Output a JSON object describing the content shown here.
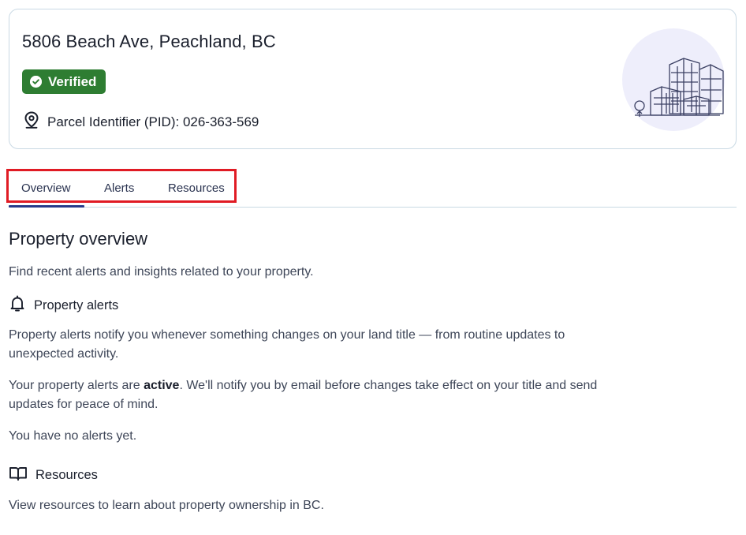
{
  "property": {
    "address": "5806 Beach Ave, Peachland, BC",
    "status_label": "Verified",
    "pid_text": "Parcel Identifier (PID): 026-363-569"
  },
  "tabs": [
    {
      "label": "Overview",
      "active": true
    },
    {
      "label": "Alerts",
      "active": false
    },
    {
      "label": "Resources",
      "active": false
    }
  ],
  "overview": {
    "title": "Property overview",
    "intro": "Find recent alerts and insights related to your property.",
    "alerts": {
      "heading": "Property alerts",
      "p1": "Property alerts notify you whenever something changes on your land title — from routine updates to unexpected activity.",
      "p2_before": "Your property alerts are ",
      "p2_bold": "active",
      "p2_after": ". We'll notify you by email before changes take effect on your title and send updates for peace of mind.",
      "empty": "You have no alerts yet."
    },
    "resources": {
      "heading": "Resources",
      "text": "View resources to learn about property ownership in BC."
    }
  },
  "colors": {
    "verified": "#2e7d32",
    "active_tab": "#273a8a",
    "highlight_frame": "#e01b24"
  },
  "icons": [
    "check-circle-icon",
    "map-pin-icon",
    "bell-icon",
    "open-book-icon",
    "building-illustration"
  ]
}
